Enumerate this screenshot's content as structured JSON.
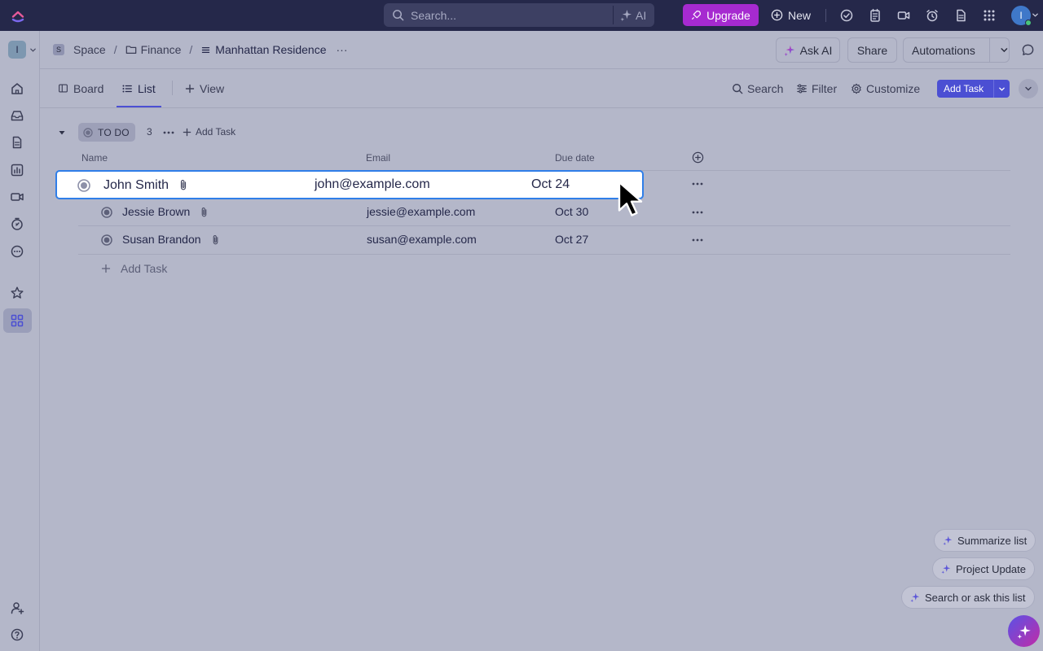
{
  "topbar": {
    "search_placeholder": "Search...",
    "ai_label": "AI",
    "upgrade_label": "Upgrade",
    "new_label": "New",
    "avatar_initial": "I"
  },
  "rail": {
    "workspace_initial": "I"
  },
  "breadcrumb": {
    "space_badge": "S",
    "space": "Space",
    "separator": "/",
    "folder": "Finance",
    "list": "Manhattan Residence",
    "more": "···"
  },
  "header_actions": {
    "ask_ai": "Ask AI",
    "share": "Share",
    "automations": "Automations"
  },
  "views": {
    "tabs": [
      {
        "label": "Board"
      },
      {
        "label": "List"
      }
    ],
    "add_view": "View",
    "search": "Search",
    "filter": "Filter",
    "customize": "Customize",
    "add_task": "Add Task"
  },
  "group": {
    "status": "TO DO",
    "count": "3",
    "add_task": "Add Task"
  },
  "table": {
    "columns": [
      "Name",
      "Email",
      "Due date"
    ],
    "rows": [
      {
        "name": "John Smith",
        "email": "john@example.com",
        "due": "Oct 24"
      },
      {
        "name": "Jessie Brown",
        "email": "jessie@example.com",
        "due": "Oct 30"
      },
      {
        "name": "Susan Brandon",
        "email": "susan@example.com",
        "due": "Oct 27"
      }
    ],
    "add_task": "Add Task"
  },
  "ai_actions": {
    "summarize": "Summarize list",
    "project_update": "Project Update",
    "search_ask": "Search or ask this list"
  },
  "colors": {
    "topbar_bg": "#25284a",
    "canvas_bg": "#b4b7c9",
    "accent": "#4b4fd3",
    "upgrade": "#a62ad0",
    "highlight_border": "#2f7ee8"
  }
}
